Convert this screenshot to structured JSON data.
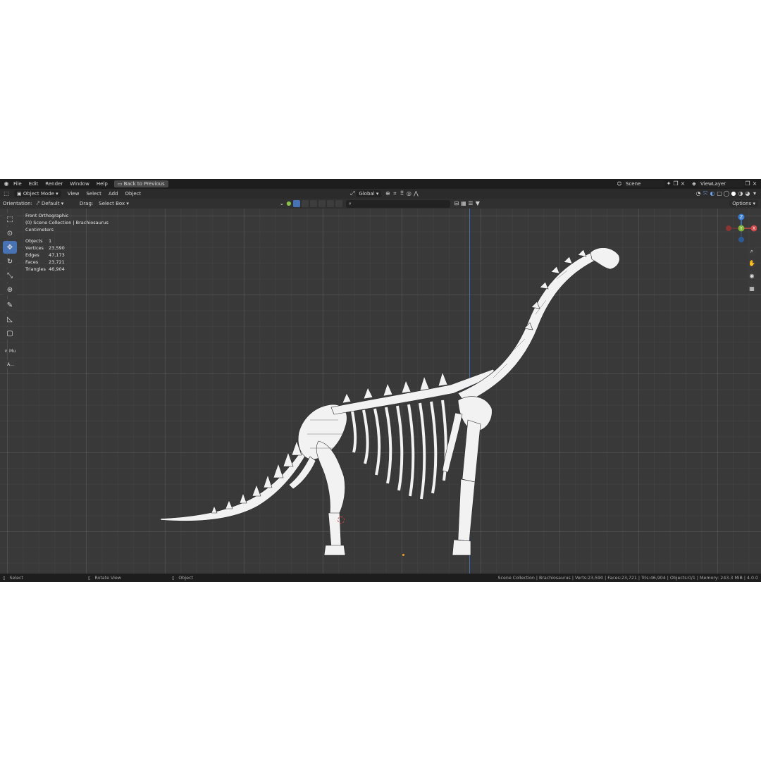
{
  "topbar": {
    "menus": [
      "File",
      "Edit",
      "Render",
      "Window",
      "Help"
    ],
    "back_button": "Back to Previous",
    "scene": "Scene",
    "view_layer": "ViewLayer"
  },
  "header": {
    "mode": "Object Mode",
    "menus": [
      "View",
      "Select",
      "Add",
      "Object"
    ],
    "transform_orientation": "Global"
  },
  "tool_settings": {
    "orientation_label": "Orientation:",
    "orientation_value": "Default",
    "drag_label": "Drag:",
    "drag_value": "Select Box",
    "options": "Options"
  },
  "viewport": {
    "view_name": "Front Orthographic",
    "collection": "(0) Scene Collection | Brachiosaurus",
    "units": "Centimeters",
    "stats": [
      {
        "label": "Objects",
        "value": "1"
      },
      {
        "label": "Vertices",
        "value": "23,590"
      },
      {
        "label": "Edges",
        "value": "47,173"
      },
      {
        "label": "Faces",
        "value": "23,721"
      },
      {
        "label": "Triangles",
        "value": "46,904"
      }
    ],
    "panel_label": "Mu",
    "panel_button": "A...",
    "gizmo": {
      "z": "Z",
      "y": "Y",
      "x": "X"
    }
  },
  "status_bar": {
    "select": "Select",
    "rotate": "Rotate View",
    "object": "Object",
    "info": "Scene Collection | Brachiosaurus | Verts:23,590 | Faces:23,721 | Tris:46,904 | Objects:0/1 | Memory: 243.3 MiB | 4.0.0"
  },
  "colors": {
    "background": "#303030",
    "grid": "#393939",
    "accent": "#4772b3",
    "axis_x": "#d04848",
    "axis_y": "#7fb434",
    "axis_z": "#3b7fd0"
  }
}
